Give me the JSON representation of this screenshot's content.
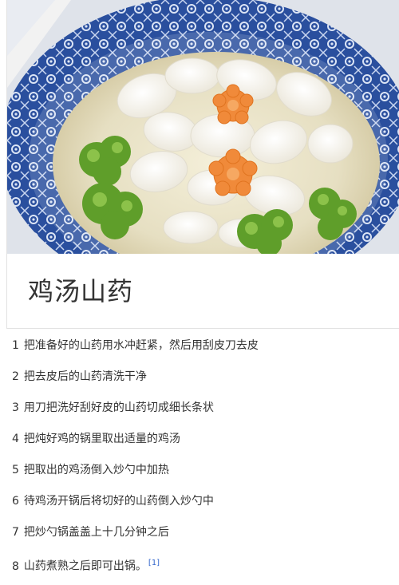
{
  "article": {
    "title": "鸡汤山药",
    "image_alt": "鸡汤山药"
  },
  "steps": [
    {
      "num": "1",
      "text": "把准备好的山药用水冲赶紧，然后用刮皮刀去皮"
    },
    {
      "num": "2",
      "text": "把去皮后的山药清洗干净"
    },
    {
      "num": "3",
      "text": "用刀把洗好刮好皮的山药切成细长条状"
    },
    {
      "num": "4",
      "text": "把炖好鸡的锅里取出适量的鸡汤"
    },
    {
      "num": "5",
      "text": "把取出的鸡汤倒入炒勺中加热"
    },
    {
      "num": "6",
      "text": "待鸡汤开锅后将切好的山药倒入炒勺中"
    },
    {
      "num": "7",
      "text": "把炒勺锅盖盖上十几分钟之后"
    },
    {
      "num": "8",
      "text": "山药煮熟之后即可出锅。",
      "ref": "[1]"
    }
  ],
  "colors": {
    "bowl_blue": "#2a4f9e",
    "broth": "#e9e3c8",
    "carrot": "#f08a3a",
    "broccoli": "#5f9e2a",
    "ref_link": "#3366cc"
  }
}
